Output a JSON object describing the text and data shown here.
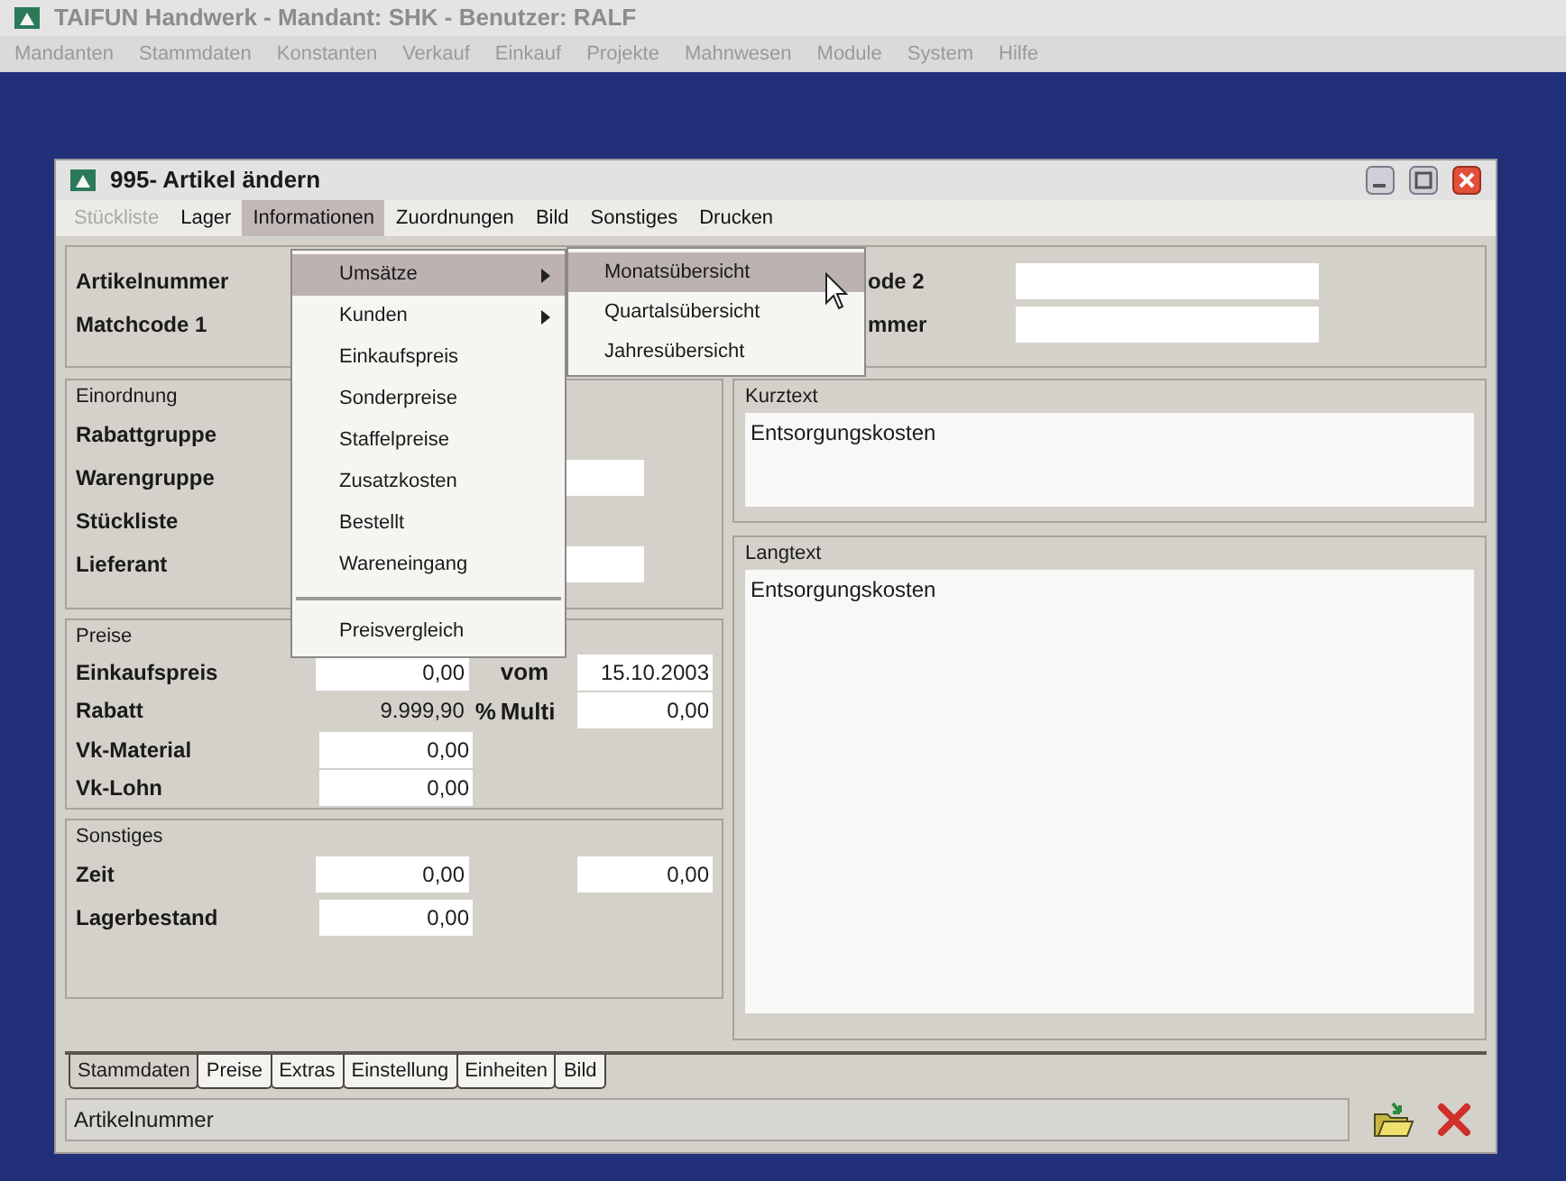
{
  "app": {
    "title": "TAIFUN Handwerk - Mandant: SHK - Benutzer: RALF",
    "menu": [
      "Mandanten",
      "Stammdaten",
      "Konstanten",
      "Verkauf",
      "Einkauf",
      "Projekte",
      "Mahnwesen",
      "Module",
      "System",
      "Hilfe"
    ]
  },
  "dialog": {
    "title": "995- Artikel ändern",
    "menu": [
      {
        "label": "Stückliste",
        "disabled": true,
        "selected": false
      },
      {
        "label": "Lager",
        "disabled": false,
        "selected": false
      },
      {
        "label": "Informationen",
        "disabled": false,
        "selected": true
      },
      {
        "label": "Zuordnungen",
        "disabled": false,
        "selected": false
      },
      {
        "label": "Bild",
        "disabled": false,
        "selected": false
      },
      {
        "label": "Sonstiges",
        "disabled": false,
        "selected": false
      },
      {
        "label": "Drucken",
        "disabled": false,
        "selected": false
      }
    ],
    "header": {
      "left_labels": [
        "Artikelnummer",
        "Matchcode 1"
      ],
      "right_labels": [
        "ode 2",
        "mmer"
      ]
    },
    "einordnung": {
      "title": "Einordnung",
      "rows": [
        {
          "label": "Rabattgruppe",
          "kind": "plain"
        },
        {
          "label": "Warengruppe",
          "kind": "field"
        },
        {
          "label": "Stückliste",
          "kind": "plain"
        },
        {
          "label": "Lieferant",
          "kind": "field"
        }
      ]
    },
    "preise": {
      "title": "Preise",
      "rows": [
        {
          "label": "Einkaufspreis",
          "kind": "field",
          "value": "0,00",
          "extra_label": "vom",
          "extra_value": "15.10.2003"
        },
        {
          "label": "Rabatt",
          "kind": "plain",
          "value": "9.999,90",
          "unit": "%",
          "extra_label": "Multi",
          "extra_value": "0,00"
        },
        {
          "label": "Vk-Material",
          "kind": "field",
          "value": "0,00"
        },
        {
          "label": "Vk-Lohn",
          "kind": "field",
          "value": "0,00"
        }
      ]
    },
    "sonstiges": {
      "title": "Sonstiges",
      "rows": [
        {
          "label": "Zeit",
          "kind": "field",
          "value": "0,00",
          "extra_value": "0,00"
        },
        {
          "label": "Lagerbestand",
          "kind": "field",
          "value": "0,00"
        }
      ]
    },
    "kurztext": {
      "title": "Kurztext",
      "value": "Entsorgungskosten"
    },
    "langtext": {
      "title": "Langtext",
      "value": "Entsorgungskosten"
    },
    "tabs": [
      {
        "label": "Stammdaten",
        "selected": true
      },
      {
        "label": "Preise",
        "selected": false
      },
      {
        "label": "Extras",
        "selected": false
      },
      {
        "label": "Einstellung",
        "selected": false
      },
      {
        "label": "Einheiten",
        "selected": false
      },
      {
        "label": "Bild",
        "selected": false
      }
    ],
    "status": "Artikelnummer",
    "dropdown": [
      {
        "kind": "item",
        "label": "Umsätze",
        "submenu": true,
        "selected": true
      },
      {
        "kind": "item",
        "label": "Kunden",
        "submenu": true,
        "selected": false
      },
      {
        "kind": "item",
        "label": "Einkaufspreis",
        "submenu": false,
        "selected": false
      },
      {
        "kind": "item",
        "label": "Sonderpreise",
        "submenu": false,
        "selected": false
      },
      {
        "kind": "item",
        "label": "Staffelpreise",
        "submenu": false,
        "selected": false
      },
      {
        "kind": "item",
        "label": "Zusatzkosten",
        "submenu": false,
        "selected": false
      },
      {
        "kind": "item",
        "label": "Bestellt",
        "submenu": false,
        "selected": false
      },
      {
        "kind": "item",
        "label": "Wareneingang",
        "submenu": false,
        "selected": false
      },
      {
        "kind": "separator"
      },
      {
        "kind": "item",
        "label": "Preisvergleich",
        "submenu": false,
        "selected": false
      }
    ],
    "submenu": [
      {
        "label": "Monatsübersicht",
        "selected": true
      },
      {
        "label": "Quartalsübersicht",
        "selected": false
      },
      {
        "label": "Jahresübersicht",
        "selected": false
      }
    ]
  }
}
